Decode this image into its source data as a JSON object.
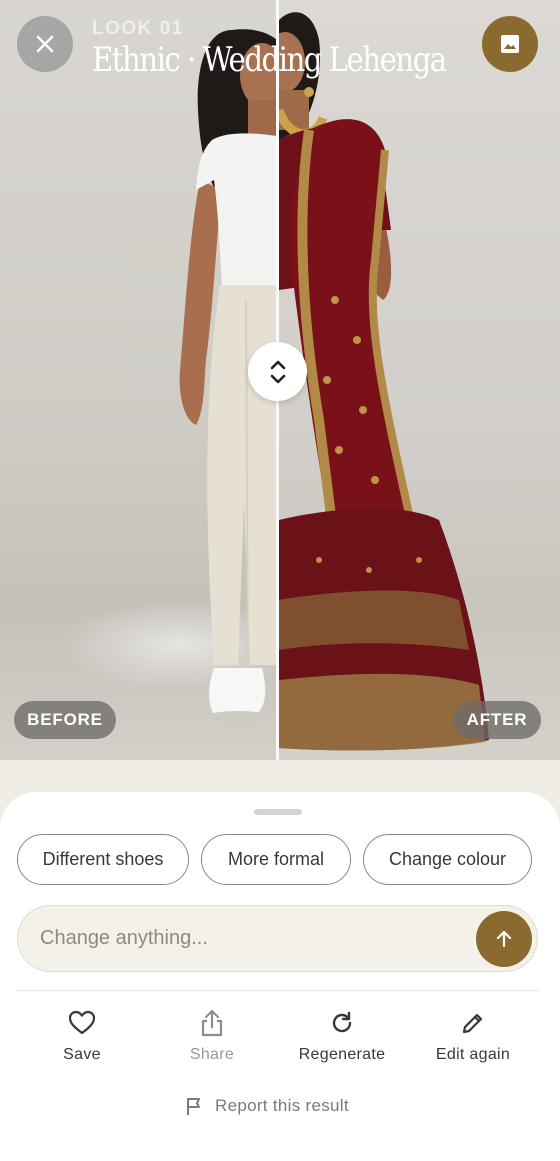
{
  "header": {
    "look_label": "LOOK 01",
    "title": "Ethnic · Wedding Lehenga"
  },
  "compare": {
    "before_label": "BEFORE",
    "after_label": "AFTER",
    "split_fraction": 0.5
  },
  "suggestions": [
    "Different shoes",
    "More formal",
    "Change colour"
  ],
  "composer": {
    "placeholder": "Change anything..."
  },
  "actions": {
    "save": "Save",
    "share": "Share",
    "regenerate": "Regenerate",
    "edit_again": "Edit again"
  },
  "report": "Report this result",
  "icons": {
    "close": "close-icon",
    "gallery": "image-icon",
    "handle": "unfold-icon",
    "send": "arrow-up-icon",
    "save": "heart-icon",
    "share": "share-icon",
    "regenerate": "refresh-icon",
    "edit": "pencil-icon",
    "report": "flag-icon"
  },
  "colors": {
    "accent": "#8b6a2f",
    "sheet": "#ffffff",
    "composer_bg": "#f4f1e9"
  }
}
